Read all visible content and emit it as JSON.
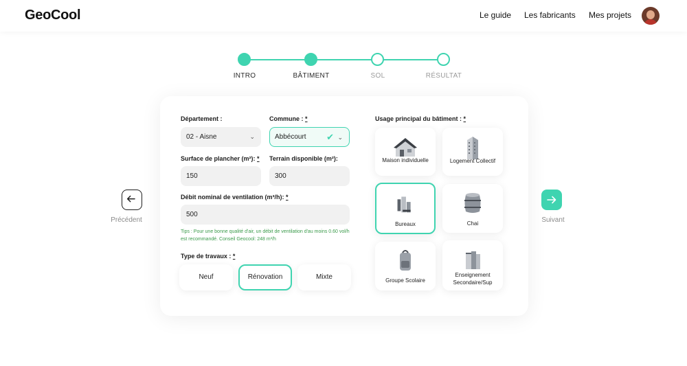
{
  "header": {
    "logo": "GeoCool",
    "nav": [
      "Le guide",
      "Les fabricants",
      "Mes projets"
    ]
  },
  "steps": [
    {
      "label": "INTRO",
      "state": "done"
    },
    {
      "label": "BÂTIMENT",
      "state": "done"
    },
    {
      "label": "SOL",
      "state": "todo"
    },
    {
      "label": "RÉSULTAT",
      "state": "todo"
    }
  ],
  "form": {
    "departement": {
      "label": "Département :",
      "value": "02 - Aisne"
    },
    "commune": {
      "label": "Commune :",
      "required": "*",
      "value": "Abbécourt"
    },
    "surface": {
      "label": "Surface de plancher (m²):",
      "required": "*",
      "value": "150"
    },
    "terrain": {
      "label": "Terrain disponible (m²):",
      "value": "300"
    },
    "debit": {
      "label": "Débit nominal de ventilation (m³/h):",
      "required": "*",
      "value": "500"
    },
    "tip": "Tips : Pour une bonne qualité d'air, un débit de ventilation d'au moins 0.60 vol/h est recommandé. Conseil Geocool: 248 m³/h",
    "travaux": {
      "label": "Type de travaux :",
      "required": "*",
      "options": [
        "Neuf",
        "Rénovation",
        "Mixte"
      ],
      "selected": "Rénovation"
    },
    "usage": {
      "label": "Usage principal du bâtiment :",
      "required": "*",
      "options": [
        {
          "label": "Maison individuelle",
          "icon": "house-icon"
        },
        {
          "label": "Logement Collectif",
          "icon": "apartment-building-icon"
        },
        {
          "label": "Bureaux",
          "icon": "office-icon"
        },
        {
          "label": "Chai",
          "icon": "wine-barrel-icon"
        },
        {
          "label": "Groupe Scolaire",
          "icon": "school-backpack-icon"
        },
        {
          "label": "Enseignement Secondaire/Sup",
          "icon": "books-icon"
        }
      ],
      "selected": "Bureaux"
    }
  },
  "navigation": {
    "prev": "Précédent",
    "next": "Suivant"
  },
  "colors": {
    "accent": "#3fd4b0",
    "tip": "#3a9a4a"
  }
}
